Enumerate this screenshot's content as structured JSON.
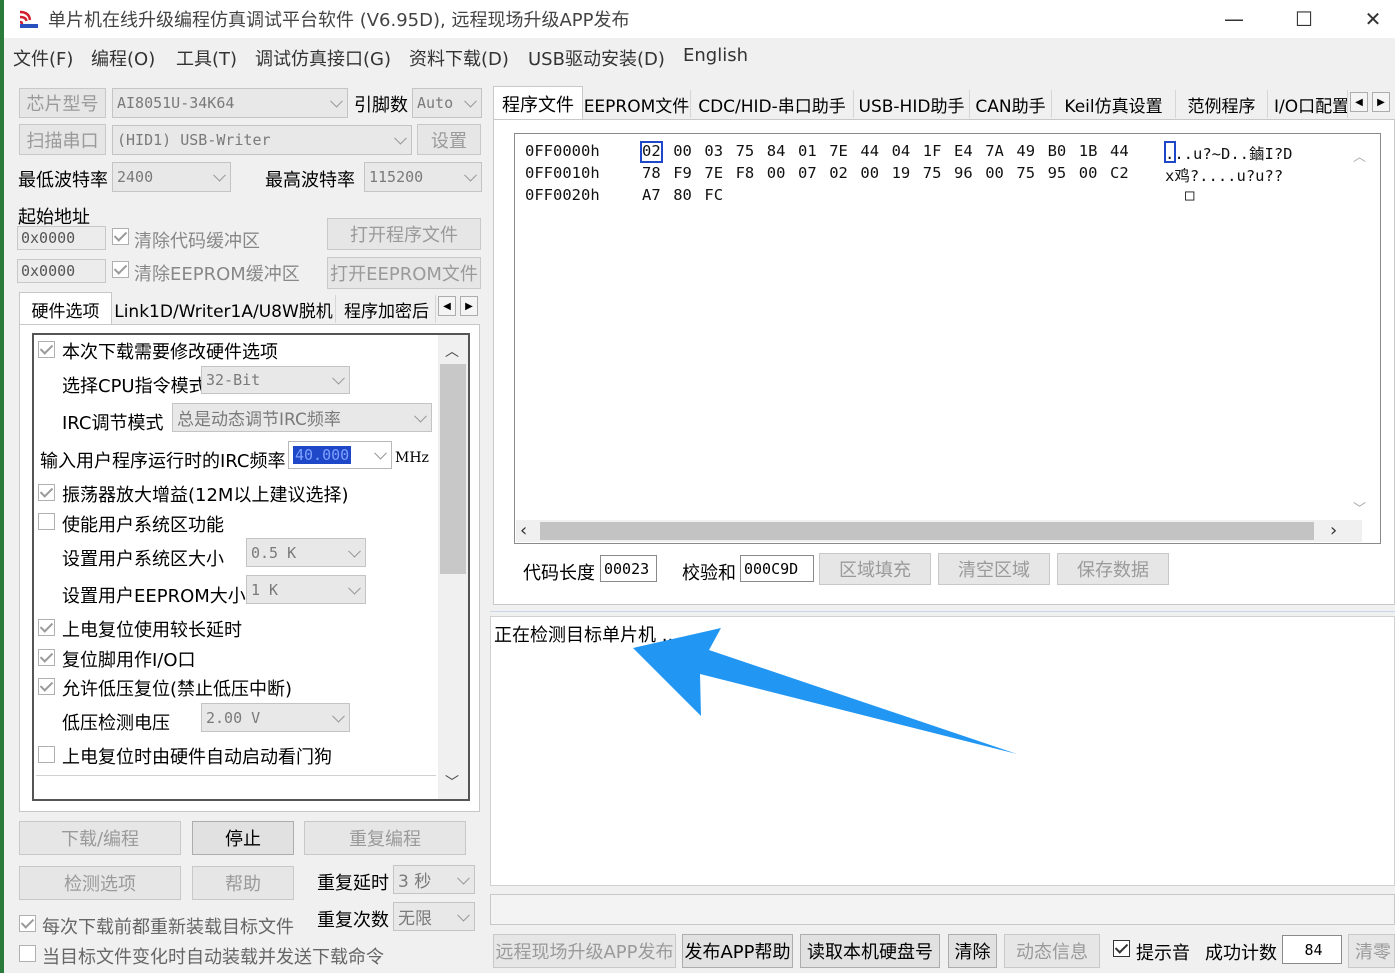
{
  "window": {
    "title": "单片机在线升级编程仿真调试平台软件 (V6.95D), 远程现场升级APP发布",
    "minimize_glyph": "—",
    "maximize_glyph": "☐",
    "close_glyph": "✕"
  },
  "menu": [
    "文件(F)",
    "编程(O)",
    "工具(T)",
    "调试仿真接口(G)",
    "资料下载(D)",
    "USB驱动安装(D)",
    "English"
  ],
  "left": {
    "chip_type_label": "芯片型号",
    "chip_type_value": "AI8051U-34K64",
    "pin_label": "引脚数",
    "pin_value": "Auto",
    "scan_port_label": "扫描串口",
    "port_value": "(HID1) USB-Writer",
    "settings_label": "设置",
    "min_baud_label": "最低波特率",
    "min_baud_value": "2400",
    "max_baud_label": "最高波特率",
    "max_baud_value": "115200",
    "start_addr_label": "起始地址",
    "code_addr_value": "0x0000",
    "clear_code_label": "清除代码缓冲区",
    "open_program_label": "打开程序文件",
    "eeprom_addr_value": "0x0000",
    "clear_eeprom_label": "清除EEPROM缓冲区",
    "open_eeprom_label": "打开EEPROM文件"
  },
  "left_tabs": [
    "硬件选项",
    "Link1D/Writer1A/U8W脱机",
    "程序加密后"
  ],
  "hw_options": {
    "modify_hw_label": "本次下载需要修改硬件选项",
    "cpu_mode_label": "选择CPU指令模式",
    "cpu_mode_value": "32-Bit",
    "irc_mode_label": "IRC调节模式",
    "irc_mode_value": "总是动态调节IRC频率",
    "irc_freq_label": "输入用户程序运行时的IRC频率",
    "irc_freq_value": "40.000",
    "irc_freq_unit": "MHz",
    "osc_gain_label": "振荡器放大增益(12M以上建议选择)",
    "user_sys_label": "使能用户系统区功能",
    "user_sys_size_label": "设置用户系统区大小",
    "user_sys_size_value": "0.5 K",
    "user_eeprom_label": "设置用户EEPROM大小",
    "user_eeprom_value": "1   K",
    "long_delay_label": "上电复位使用较长延时",
    "reset_io_label": "复位脚用作I/O口",
    "lvr_label": "允许低压复位(禁止低压中断)",
    "lv_detect_label": "低压检测电压",
    "lv_detect_value": "2.00 V",
    "wdt_label": "上电复位时由硬件自动启动看门狗"
  },
  "actions": {
    "download_label": "下载/编程",
    "stop_label": "停止",
    "repeat_label": "重复编程",
    "detect_label": "检测选项",
    "help_label": "帮助",
    "repeat_delay_label": "重复延时",
    "repeat_delay_value": "3 秒",
    "repeat_count_label": "重复次数",
    "repeat_count_value": "无限",
    "reload_label": "每次下载前都重新装载目标文件",
    "auto_load_label": "当目标文件变化时自动装载并发送下载命令"
  },
  "right_tabs": [
    "程序文件",
    "EEPROM文件",
    "CDC/HID-串口助手",
    "USB-HID助手",
    "CAN助手",
    "Keil仿真设置",
    "范例程序",
    "I/O口配置"
  ],
  "hex": {
    "rows": [
      {
        "addr": "0FF0000h",
        "bytes": [
          "02",
          "00",
          "03",
          "75",
          "84",
          "01",
          "7E",
          "44",
          "04",
          "1F",
          "E4",
          "7A",
          "49",
          "B0",
          "1B",
          "44"
        ],
        "ascii": "...u?~D..鏀I?D"
      },
      {
        "addr": "0FF0010h",
        "bytes": [
          "78",
          "F9",
          "7E",
          "F8",
          "00",
          "07",
          "02",
          "00",
          "19",
          "75",
          "96",
          "00",
          "75",
          "95",
          "00",
          "C2"
        ],
        "ascii": "x鸡?....u?u??"
      },
      {
        "addr": "0FF0020h",
        "bytes": [
          "A7",
          "80",
          "FC"
        ],
        "ascii": "□"
      }
    ],
    "code_len_label": "代码长度",
    "code_len_value": "00023",
    "checksum_label": "校验和",
    "checksum_value": "000C9D",
    "fill_label": "区域填充",
    "clear_area_label": "清空区域",
    "save_label": "保存数据"
  },
  "log": {
    "message": "正在检测目标单片机 ..."
  },
  "bottom": {
    "publish_label": "远程现场升级APP发布",
    "publish_help_label": "发布APP帮助",
    "read_disk_label": "读取本机硬盘号",
    "clear_label": "清除",
    "dynamic_label": "动态信息",
    "beep_label": "提示音",
    "success_label": "成功计数",
    "success_value": "84",
    "clear_count_label": "清零"
  },
  "colors": {
    "arrow": "#2196f3",
    "selection": "#1f48c9"
  }
}
